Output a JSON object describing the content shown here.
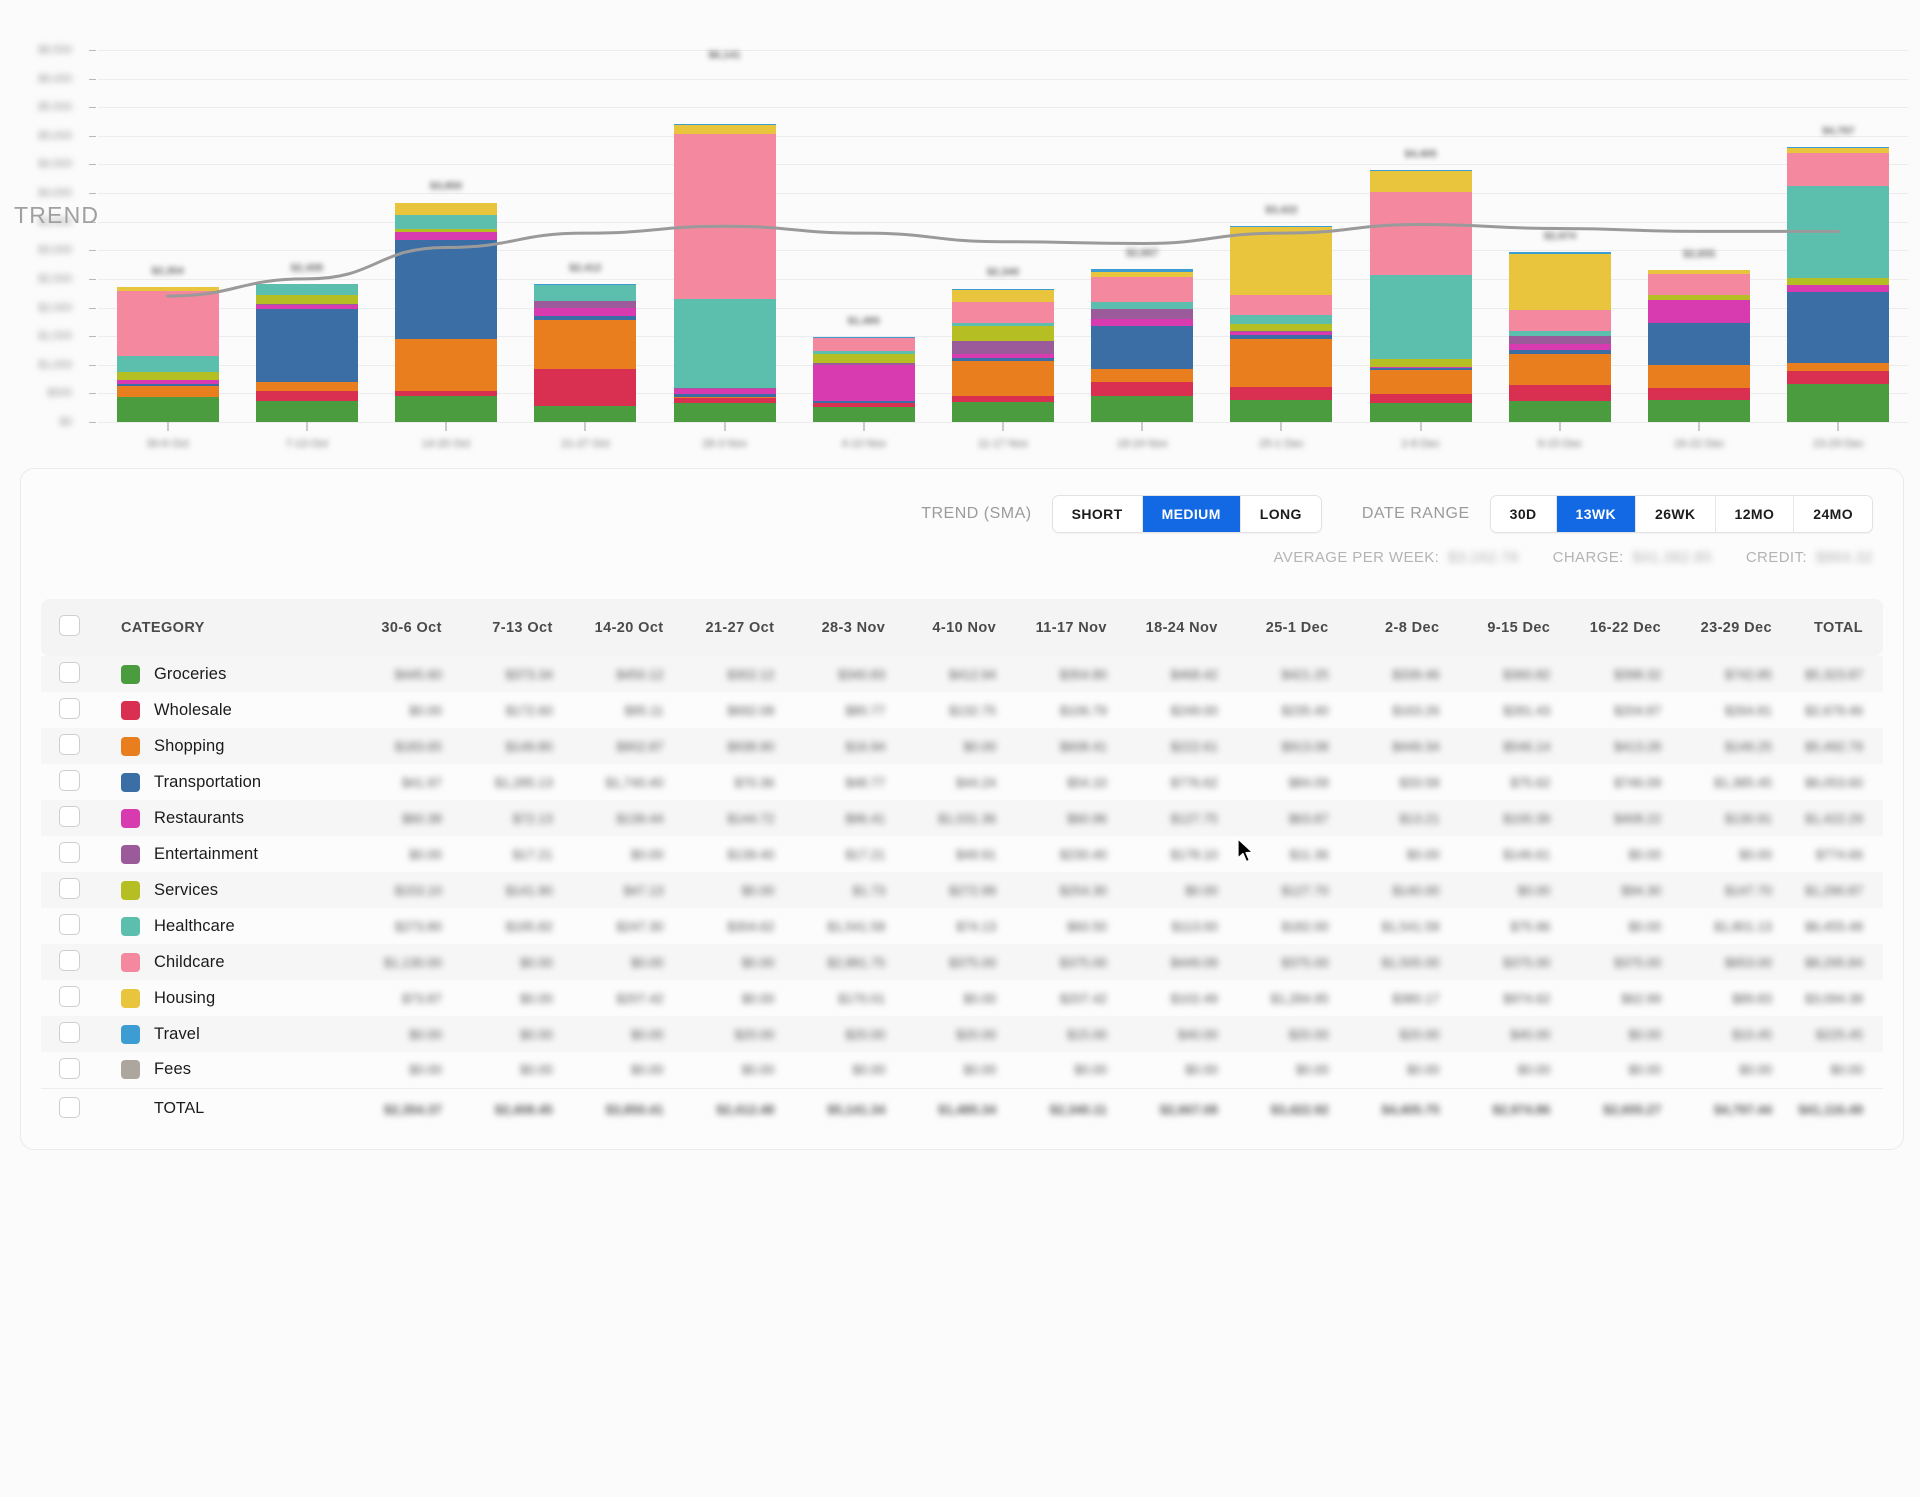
{
  "chart_data": {
    "type": "bar",
    "stacked": true,
    "title": "",
    "xlabel": "",
    "ylabel": "",
    "grid": true,
    "legend_position": "table",
    "annotation": "TREND",
    "masked_values": true,
    "y_axis": {
      "ticks": [
        "$6,500",
        "$6,000",
        "$5,500",
        "$5,000",
        "$4,500",
        "$4,000",
        "$3,500",
        "$3,000",
        "$2,500",
        "$2,000",
        "$1,500",
        "$1,000",
        "$500",
        "$0"
      ],
      "min": 0,
      "max": 6500
    },
    "categories": [
      "30-6 Oct",
      "7-13 Oct",
      "14-20 Oct",
      "21-27 Oct",
      "28-3 Nov",
      "4-10 Nov",
      "11-17 Nov",
      "18-24 Nov",
      "25-1 Dec",
      "2-8 Dec",
      "9-15 Dec",
      "16-22 Dec",
      "23-29 Dec"
    ],
    "bar_labels": [
      "$2,354",
      "$2,408",
      "$3,850",
      "$2,412",
      "$6,141",
      "$1,485",
      "$2,340",
      "$2,667",
      "$3,422",
      "$4,405",
      "$2,974",
      "$2,655",
      "$4,797"
    ],
    "totals": [
      2354.37,
      2408.45,
      3850.41,
      2412.48,
      6141.34,
      1485.34,
      2340.11,
      2667.08,
      3422.92,
      4405.75,
      2974.86,
      2655.27,
      4797.44
    ],
    "series": [
      {
        "name": "Groceries",
        "color": "#4a9c3e",
        "values": [
          445.6,
          373.34,
          450.12,
          302.12,
          340.83,
          412.94,
          354.8,
          468.42,
          421.25,
          339.46,
          360.82,
          398.32,
          742.85
        ]
      },
      {
        "name": "Wholesale",
        "color": "#d92f51",
        "values": [
          0,
          172.6,
          95.11,
          692.08,
          80.77,
          132.75,
          106.79,
          249.0,
          235.4,
          163.26,
          281.43,
          204.87,
          264.81
        ]
      },
      {
        "name": "Shopping",
        "color": "#e87e1d",
        "values": [
          183.65,
          149.8,
          902.87,
          938.9,
          16.94,
          0,
          608.41,
          222.61,
          913.08,
          449.34,
          546.14,
          413.28,
          149.25
        ]
      },
      {
        "name": "Transportation",
        "color": "#3a6ea5",
        "values": [
          41.97,
          1285.13,
          1740.4,
          70.36,
          48.77,
          44.24,
          54.1,
          776.62,
          84.09,
          33.58,
          75.62,
          746.09,
          1385.45
        ]
      },
      {
        "name": "Restaurants",
        "color": "#d83bb0",
        "values": [
          60.38,
          72.13,
          139.44,
          144.72,
          96.41,
          1031.36,
          60.96,
          127.75,
          63.87,
          13.21,
          100.39,
          408.22,
          130.91
        ]
      },
      {
        "name": "Entertainment",
        "color": "#9b5b9b",
        "values": [
          0,
          17.21,
          0,
          139.4,
          17.21,
          49.91,
          230.4,
          178.1,
          11.36,
          0,
          146.61,
          0,
          0
        ]
      },
      {
        "name": "Services",
        "color": "#b5bf24",
        "values": [
          153.1,
          141.9,
          47.13,
          0,
          1.73,
          272.99,
          254.3,
          0,
          127.7,
          140.0,
          0,
          94.3,
          147.7
        ]
      },
      {
        "name": "Healthcare",
        "color": "#5cbfae",
        "values": [
          273.8,
          195.82,
          247.3,
          304.62,
          1541.58,
          74.13,
          60.5,
          113.0,
          182.0,
          1541.58,
          75.96,
          0,
          1801.13
        ]
      },
      {
        "name": "Childcare",
        "color": "#f4889f",
        "values": [
          1130.0,
          0,
          0,
          0,
          2881.75,
          375.0,
          375.0,
          449.09,
          375.0,
          1505.0,
          375.0,
          375.0,
          653.0
        ]
      },
      {
        "name": "Housing",
        "color": "#e8c53c",
        "values": [
          73.87,
          0,
          207.42,
          0,
          170.01,
          0,
          207.42,
          102.49,
          1284.95,
          380.17,
          974.62,
          62.99,
          89.83
        ]
      },
      {
        "name": "Travel",
        "color": "#3d9cd2",
        "values": [
          0,
          0,
          0,
          20.0,
          20.0,
          20.0,
          15.0,
          40.0,
          20.0,
          20.0,
          40.0,
          0,
          10.45
        ]
      },
      {
        "name": "Fees",
        "color": "#ada69e",
        "values": [
          0,
          0,
          0,
          0,
          0,
          0,
          0,
          0,
          0,
          0,
          0,
          0,
          0
        ]
      }
    ],
    "trend": {
      "name": "TREND",
      "color": "#9a9a9a",
      "values": [
        2200,
        2500,
        3050,
        3300,
        3420,
        3300,
        3150,
        3120,
        3300,
        3450,
        3380,
        3330,
        3330
      ]
    }
  },
  "controls": {
    "trend_label": "TREND (SMA)",
    "trend_options": [
      {
        "label": "SHORT",
        "active": false
      },
      {
        "label": "MEDIUM",
        "active": true
      },
      {
        "label": "LONG",
        "active": false
      }
    ],
    "range_label": "DATE RANGE",
    "range_options": [
      {
        "label": "30D",
        "active": false
      },
      {
        "label": "13WK",
        "active": true
      },
      {
        "label": "26WK",
        "active": false
      },
      {
        "label": "12MO",
        "active": false
      },
      {
        "label": "24MO",
        "active": false
      }
    ],
    "accent_color": "#1269e3"
  },
  "summary": {
    "average_label": "AVERAGE PER WEEK:",
    "average_value": "$3,162.76",
    "charge_label": "CHARGE:",
    "charge_value": "$41,382.85",
    "credit_label": "CREDIT:",
    "credit_value": "$864.32"
  },
  "table": {
    "columns": [
      "CATEGORY",
      "30-6 Oct",
      "7-13 Oct",
      "14-20 Oct",
      "21-27 Oct",
      "28-3 Nov",
      "4-10 Nov",
      "11-17 Nov",
      "18-24 Nov",
      "25-1 Dec",
      "2-8 Dec",
      "9-15 Dec",
      "16-22 Dec",
      "23-29 Dec",
      "TOTAL"
    ],
    "rows": [
      {
        "category": "Groceries",
        "color": "#4a9c3e",
        "checked": false,
        "values": [
          "$445.60",
          "$373.34",
          "$450.12",
          "$302.12",
          "$340.83",
          "$412.94",
          "$354.80",
          "$468.42",
          "$421.25",
          "$339.46",
          "$360.82",
          "$398.32",
          "$742.85"
        ],
        "total": "$5,323.87"
      },
      {
        "category": "Wholesale",
        "color": "#d92f51",
        "checked": false,
        "values": [
          "$0.00",
          "$172.60",
          "$95.11",
          "$692.08",
          "$80.77",
          "$132.75",
          "$106.79",
          "$249.00",
          "$235.40",
          "$163.26",
          "$281.43",
          "$204.87",
          "$264.81"
        ],
        "total": "$2,679.46"
      },
      {
        "category": "Shopping",
        "color": "#e87e1d",
        "checked": false,
        "values": [
          "$183.65",
          "$149.80",
          "$902.87",
          "$938.90",
          "$16.94",
          "$0.00",
          "$608.41",
          "$222.61",
          "$913.08",
          "$449.34",
          "$546.14",
          "$413.28",
          "$149.25"
        ],
        "total": "$5,492.79"
      },
      {
        "category": "Transportation",
        "color": "#3a6ea5",
        "checked": false,
        "values": [
          "$41.97",
          "$1,285.13",
          "$1,740.40",
          "$70.36",
          "$48.77",
          "$44.24",
          "$54.10",
          "$776.62",
          "$84.09",
          "$33.58",
          "$75.62",
          "$746.09",
          "$1,385.45"
        ],
        "total": "$6,053.60"
      },
      {
        "category": "Restaurants",
        "color": "#d83bb0",
        "checked": false,
        "values": [
          "$60.38",
          "$72.13",
          "$139.44",
          "$144.72",
          "$96.41",
          "$1,031.36",
          "$60.96",
          "$127.75",
          "$63.87",
          "$13.21",
          "$100.39",
          "$408.22",
          "$130.91"
        ],
        "total": "$1,422.29"
      },
      {
        "category": "Entertainment",
        "color": "#9b5b9b",
        "checked": false,
        "values": [
          "$0.00",
          "$17.21",
          "$0.00",
          "$139.40",
          "$17.21",
          "$49.91",
          "$230.40",
          "$178.10",
          "$11.36",
          "$0.00",
          "$146.61",
          "$0.00",
          "$0.00"
        ],
        "total": "$774.66"
      },
      {
        "category": "Services",
        "color": "#b5bf24",
        "checked": false,
        "values": [
          "$153.10",
          "$141.90",
          "$47.13",
          "$0.00",
          "$1.73",
          "$272.99",
          "$254.30",
          "$0.00",
          "$127.70",
          "$140.00",
          "$0.00",
          "$94.30",
          "$147.70"
        ],
        "total": "$1,290.87"
      },
      {
        "category": "Healthcare",
        "color": "#5cbfae",
        "checked": false,
        "values": [
          "$273.80",
          "$195.82",
          "$247.30",
          "$304.62",
          "$1,541.58",
          "$74.13",
          "$60.50",
          "$113.00",
          "$182.00",
          "$1,541.58",
          "$75.96",
          "$0.00",
          "$1,801.13"
        ],
        "total": "$6,455.48"
      },
      {
        "category": "Childcare",
        "color": "#f4889f",
        "checked": false,
        "values": [
          "$1,130.00",
          "$0.00",
          "$0.00",
          "$0.00",
          "$2,881.75",
          "$375.00",
          "$375.00",
          "$449.09",
          "$375.00",
          "$1,505.00",
          "$375.00",
          "$375.00",
          "$653.00"
        ],
        "total": "$8,295.84"
      },
      {
        "category": "Housing",
        "color": "#e8c53c",
        "checked": false,
        "values": [
          "$73.87",
          "$0.00",
          "$207.42",
          "$0.00",
          "$170.01",
          "$0.00",
          "$207.42",
          "$102.49",
          "$1,284.95",
          "$380.17",
          "$974.62",
          "$62.99",
          "$89.83"
        ],
        "total": "$3,094.38"
      },
      {
        "category": "Travel",
        "color": "#3d9cd2",
        "checked": false,
        "values": [
          "$0.00",
          "$0.00",
          "$0.00",
          "$20.00",
          "$20.00",
          "$20.00",
          "$15.00",
          "$40.00",
          "$20.00",
          "$20.00",
          "$40.00",
          "$0.00",
          "$10.45"
        ],
        "total": "$225.45"
      },
      {
        "category": "Fees",
        "color": "#ada69e",
        "checked": false,
        "values": [
          "$0.00",
          "$0.00",
          "$0.00",
          "$0.00",
          "$0.00",
          "$0.00",
          "$0.00",
          "$0.00",
          "$0.00",
          "$0.00",
          "$0.00",
          "$0.00",
          "$0.00"
        ],
        "total": "$0.00"
      }
    ],
    "total_row": {
      "label": "TOTAL",
      "values": [
        "$2,354.37",
        "$2,408.45",
        "$3,850.41",
        "$2,412.48",
        "$5,141.34",
        "$1,485.34",
        "$2,340.11",
        "$2,667.08",
        "$3,422.92",
        "$4,405.75",
        "$2,974.86",
        "$2,655.27",
        "$4,797.44"
      ],
      "total": "$41,116.49"
    }
  }
}
